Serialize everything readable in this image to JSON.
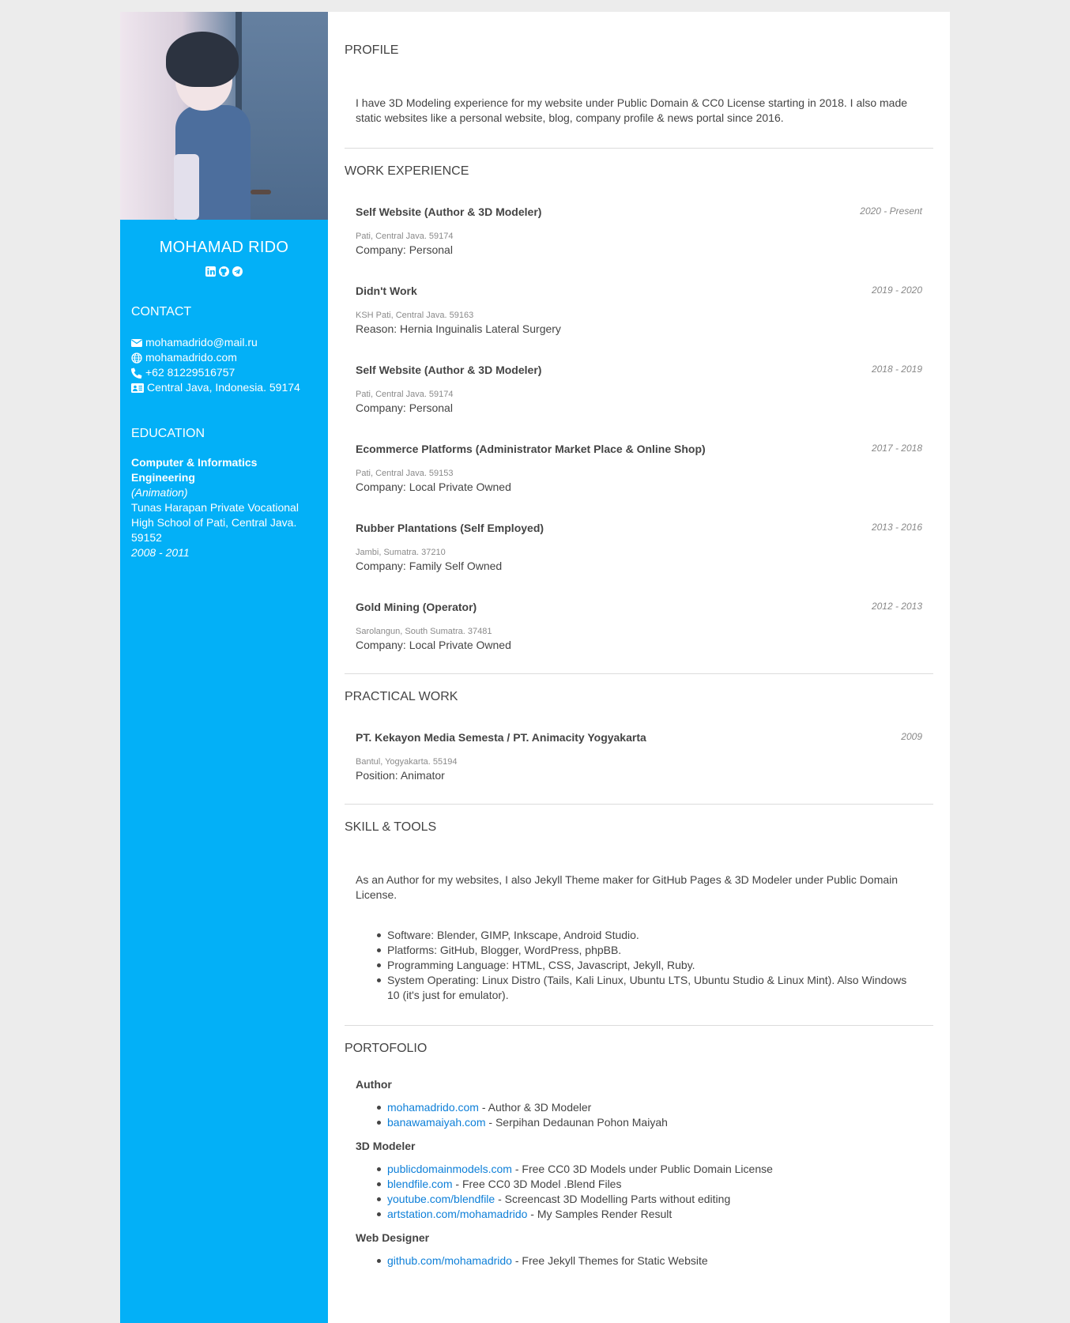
{
  "sidebar": {
    "name": "MOHAMAD RIDO",
    "social_icons": [
      "linkedin-icon",
      "github-icon",
      "telegram-icon"
    ],
    "contact": {
      "title": "CONTACT",
      "email": "mohamadrido@mail.ru",
      "website": "mohamadrido.com",
      "phone": "+62 81229516757",
      "address": "Central Java, Indonesia. 59174"
    },
    "education": {
      "title": "EDUCATION",
      "degree": "Computer & Informatics Engineering",
      "major": "(Animation)",
      "school": "Tunas Harapan Private Vocational High School of Pati, Central Java. 59152",
      "years": "2008 - 2011"
    }
  },
  "profile": {
    "title": "PROFILE",
    "text": "I have 3D Modeling experience for my website under Public Domain & CC0 License starting in 2018. I also made static websites like a personal website, blog, company profile & news portal since 2016."
  },
  "work": {
    "title": "WORK EXPERIENCE",
    "jobs": [
      {
        "title": "Self Website (Author & 3D Modeler)",
        "date": "2020 - Present",
        "location": "Pati, Central Java. 59174",
        "desc": "Company: Personal"
      },
      {
        "title": "Didn't Work",
        "date": "2019 - 2020",
        "location": "KSH Pati, Central Java. 59163",
        "desc": "Reason: Hernia Inguinalis Lateral Surgery"
      },
      {
        "title": "Self Website (Author & 3D Modeler)",
        "date": "2018 - 2019",
        "location": "Pati, Central Java. 59174",
        "desc": "Company: Personal"
      },
      {
        "title": "Ecommerce Platforms (Administrator Market Place & Online Shop)",
        "date": "2017 - 2018",
        "location": "Pati, Central Java. 59153",
        "desc": "Company: Local Private Owned"
      },
      {
        "title": "Rubber Plantations (Self Employed)",
        "date": "2013 - 2016",
        "location": "Jambi, Sumatra. 37210",
        "desc": "Company: Family Self Owned"
      },
      {
        "title": "Gold Mining (Operator)",
        "date": "2012 - 2013",
        "location": "Sarolangun, South Sumatra. 37481",
        "desc": "Company: Local Private Owned"
      }
    ]
  },
  "practical": {
    "title": "PRACTICAL WORK",
    "item": {
      "title": "PT. Kekayon Media Semesta / PT. Animacity Yogyakarta",
      "date": "2009",
      "location": "Bantul, Yogyakarta. 55194",
      "desc": "Position: Animator"
    }
  },
  "skills": {
    "title": "SKILL & TOOLS",
    "intro": "As an Author for my websites, I also Jekyll Theme maker for GitHub Pages & 3D Modeler under Public Domain License.",
    "items": [
      "Software: Blender, GIMP, Inkscape, Android Studio.",
      "Platforms: GitHub, Blogger, WordPress, phpBB.",
      "Programming Language: HTML, CSS, Javascript, Jekyll, Ruby.",
      "System Operating: Linux Distro (Tails, Kali Linux, Ubuntu LTS, Ubuntu Studio & Linux Mint). Also Windows 10 (it's just for emulator)."
    ]
  },
  "portfolio": {
    "title": "PORTOFOLIO",
    "groups": [
      {
        "title": "Author",
        "items": [
          {
            "link": "mohamadrido.com",
            "desc": " - Author & 3D Modeler"
          },
          {
            "link": "banawamaiyah.com",
            "desc": " - Serpihan Dedaunan Pohon Maiyah"
          }
        ]
      },
      {
        "title": "3D Modeler",
        "items": [
          {
            "link": "publicdomainmodels.com",
            "desc": " - Free CC0 3D Models under Public Domain License"
          },
          {
            "link": "blendfile.com",
            "desc": " - Free CC0 3D Model .Blend Files"
          },
          {
            "link": "youtube.com/blendfile",
            "desc": " - Screencast 3D Modelling Parts without editing"
          },
          {
            "link": "artstation.com/mohamadrido",
            "desc": " - My Samples Render Result"
          }
        ]
      },
      {
        "title": "Web Designer",
        "items": [
          {
            "link": "github.com/mohamadrido",
            "desc": " - Free Jekyll Themes for Static Website"
          }
        ]
      }
    ]
  },
  "colors": {
    "sidebar": "#03b0f7",
    "link": "#0d7fd8",
    "background": "#ececec"
  }
}
